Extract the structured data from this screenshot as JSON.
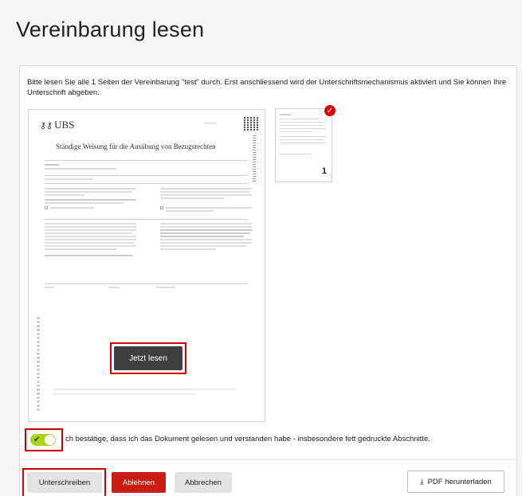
{
  "page": {
    "title": "Vereinbarung lesen",
    "intro": "Bitte lesen Sie alle 1 Seiten der Vereinbarung \"test\" durch. Erst anschliessend wird der Unterschriftsmechanismus aktiviert und Sie können Ihre Unterschrift abgeben."
  },
  "document": {
    "logo": "UBS",
    "heading": "Ständige Weisung für die Ausübung von Bezugsrechten",
    "read_button": "Jetzt lesen"
  },
  "thumbnail": {
    "page_number": "1",
    "badge_icon": "check-icon"
  },
  "confirm": {
    "checked": true,
    "label": "ch bestätige, dass ich das Dokument gelesen und verstanden habe - insbesondere fett gedruckte Abschnitte.",
    "toggle_color": "#aed31f"
  },
  "actions": {
    "sign": "Unterschreiben",
    "decline": "Ablehnen",
    "cancel": "Abbrechen",
    "pdf": "PDF herunterladen",
    "decline_color": "#c81d10",
    "highlight_color": "#cc0000"
  }
}
